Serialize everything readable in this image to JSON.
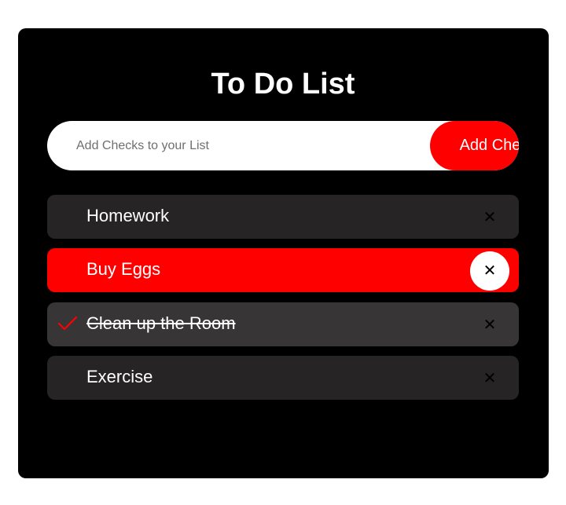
{
  "app": {
    "title": "To Do List"
  },
  "input": {
    "placeholder": "Add Checks to your List",
    "value": ""
  },
  "add_button": {
    "label": "Add Check"
  },
  "items": [
    {
      "label": "Homework",
      "checked": false,
      "highlighted": false,
      "close_glyph": "✕"
    },
    {
      "label": "Buy Eggs",
      "checked": false,
      "highlighted": true,
      "close_glyph": "✕"
    },
    {
      "label": "Clean up the Room",
      "checked": true,
      "highlighted": false,
      "close_glyph": "✕"
    },
    {
      "label": "Exercise",
      "checked": false,
      "highlighted": false,
      "close_glyph": "✕"
    }
  ],
  "colors": {
    "accent": "#ff0000",
    "card_background": "#000000",
    "item_background": "#262424",
    "checked_item_background": "#373535"
  },
  "icons": {
    "check": "check-icon",
    "close": "close-icon"
  }
}
